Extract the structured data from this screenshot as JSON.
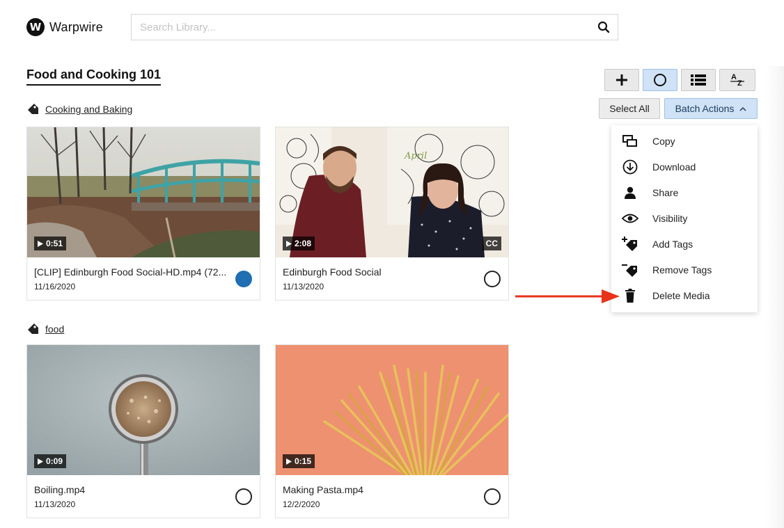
{
  "app": {
    "logo_letter": "W",
    "name": "Warpwire"
  },
  "search": {
    "placeholder": "Search Library...",
    "value": ""
  },
  "page": {
    "title": "Food and Cooking 101"
  },
  "toolbar": {
    "select_all": "Select All",
    "batch_actions": "Batch Actions"
  },
  "groups": [
    {
      "tag": "Cooking and Baking",
      "items": [
        {
          "title": "[CLIP] Edinburgh Food Social-HD.mp4 (72...",
          "date": "11/16/2020",
          "duration": "0:51",
          "cc": "",
          "selected": true
        },
        {
          "title": "Edinburgh Food Social",
          "date": "11/13/2020",
          "duration": "2:08",
          "cc": "CC",
          "selected": false
        }
      ]
    },
    {
      "tag": "food",
      "items": [
        {
          "title": "Boiling.mp4",
          "date": "11/13/2020",
          "duration": "0:09",
          "cc": "",
          "selected": false
        },
        {
          "title": "Making Pasta.mp4",
          "date": "12/2/2020",
          "duration": "0:15",
          "cc": "",
          "selected": false
        }
      ]
    }
  ],
  "batch_menu": [
    {
      "label": "Copy",
      "icon": "copy-icon"
    },
    {
      "label": "Download",
      "icon": "download-icon"
    },
    {
      "label": "Share",
      "icon": "user-icon"
    },
    {
      "label": "Visibility",
      "icon": "eye-icon"
    },
    {
      "label": "Add Tags",
      "icon": "add-tag-icon"
    },
    {
      "label": "Remove Tags",
      "icon": "remove-tag-icon"
    },
    {
      "label": "Delete Media",
      "icon": "trash-icon"
    }
  ],
  "colors": {
    "accent": "#1f6fb2",
    "active_bg": "#cfe2f6",
    "annotation_arrow": "#e8321a"
  }
}
